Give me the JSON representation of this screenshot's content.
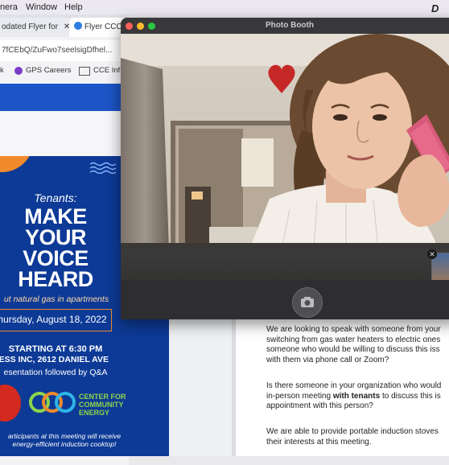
{
  "menubar": {
    "items": [
      "nera",
      "Window",
      "Help"
    ],
    "right_glyph": "D"
  },
  "browser": {
    "tabs": [
      {
        "label": "odated Flyer for",
        "close": "✕"
      },
      {
        "label": "Flyer CCC"
      }
    ],
    "url": "7fCEbQ/ZuFwo7seelsigDfhel...",
    "bookmarks": [
      {
        "label": "k"
      },
      {
        "label": "GPS Careers",
        "icon": "gps-icon"
      },
      {
        "label": "CCE Inf",
        "icon": "folder-icon"
      }
    ]
  },
  "flyer": {
    "tenants": "Tenants:",
    "headline": [
      "MAKE",
      "YOUR",
      "VOICE",
      "HEARD"
    ],
    "subtitle": "ut natural gas in apartments",
    "date": "hursday, August 18, 2022",
    "start": "STARTING AT 6:30 PM",
    "location": "CESS INC, 2612 DANIEL AVE",
    "presentation": "esentation followed by Q&A",
    "center_lines": [
      "CENTER FOR",
      "COMMUNITY",
      "ENERGY"
    ],
    "footer": [
      "articipants at this meeting will receive",
      "energy-efficient induction cooktop!"
    ],
    "colors": {
      "bg": "#0d3a96",
      "accent": "#f08a2a",
      "green": "#8ed44b"
    }
  },
  "document": {
    "p1": [
      "We are looking to speak with someone from your",
      "switching from gas water heaters to electric ones",
      "someone who would be willing to discuss this iss",
      "with them via phone call or Zoom?"
    ],
    "p2_lines": [
      "Is there someone in your organization who would",
      "in-person meeting ",
      "appointment with this person?"
    ],
    "p2_bold": "with tenants",
    "p2_tail": " to discuss this is",
    "p3": [
      "We are able to provide portable induction stoves",
      "their interests at this meeting."
    ]
  },
  "photobooth": {
    "title": "Photo Booth",
    "thumb_close": "✕",
    "shutter_icon": "camera-icon"
  }
}
